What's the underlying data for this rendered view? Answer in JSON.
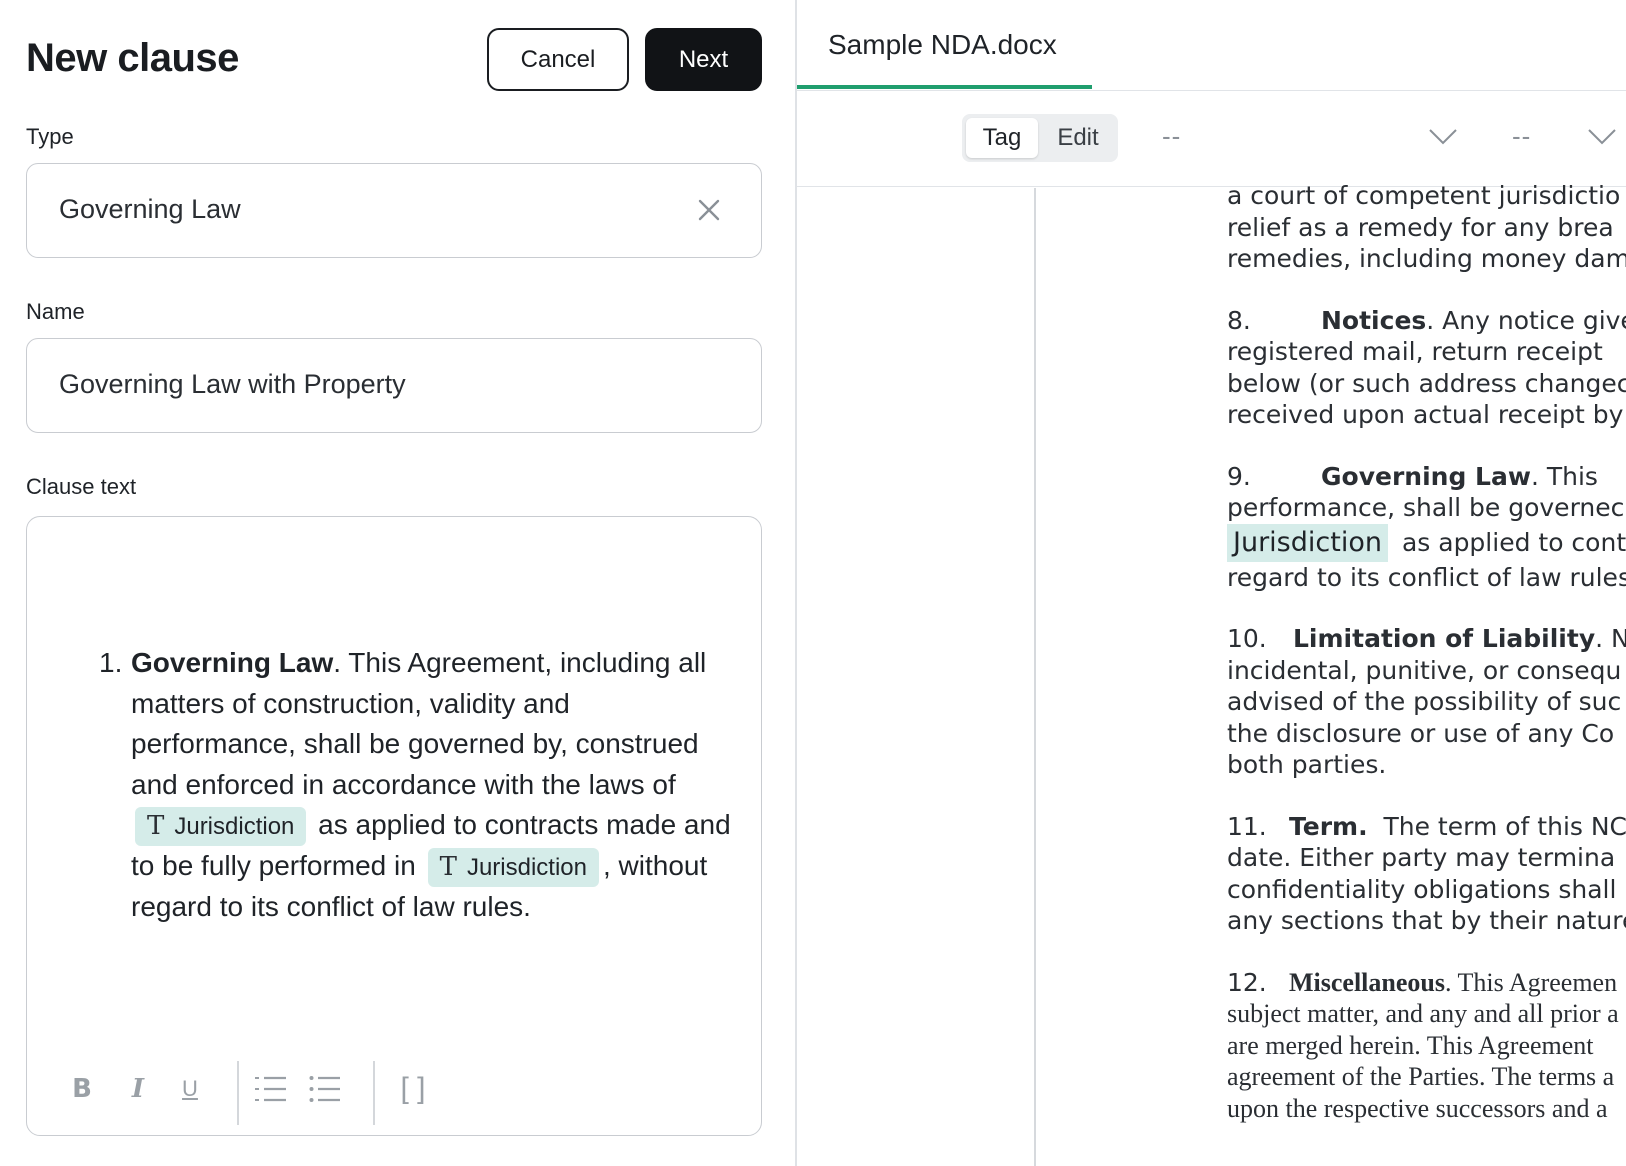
{
  "panel": {
    "title": "New clause",
    "cancel_label": "Cancel",
    "next_label": "Next"
  },
  "type_field": {
    "label": "Type",
    "value": "Governing Law"
  },
  "name_field": {
    "label": "Name",
    "value": "Governing Law with Property"
  },
  "clause_field": {
    "label": "Clause text",
    "number": "1.",
    "heading": "Governing Law",
    "text_1": ". This Agreement, including all matters of construction, validity and performance, shall be governed by, construed and enforced in accordance with the laws of",
    "chip_1": "Jurisdiction",
    "text_2": "as applied to contracts made and to be fully performed in",
    "chip_2": "Jurisdiction",
    "text_3": ", without regard to its conflict of law rules."
  },
  "toolbar": {
    "bold": "B",
    "italic": "I",
    "underline": "U",
    "brackets": "[ ]"
  },
  "document": {
    "tab_title": "Sample NDA.docx",
    "mode_tag": "Tag",
    "mode_edit": "Edit",
    "dash_1": "--",
    "dash_2": "--",
    "lines": {
      "p7_l1": "a court of competent jurisdictio",
      "p7_l2": "relief as a remedy for any brea",
      "p7_l3": "remedies, including money dama",
      "p8_num": "8.",
      "p8_head": "Notices",
      "p8_l1": ". Any notice give",
      "p8_l2": "registered mail, return receipt",
      "p8_l3": "below (or such address changec",
      "p8_l4": "received upon actual receipt by",
      "p9_num": "9.",
      "p9_head": "Governing Law",
      "p9_l1": ". This",
      "p9_l2": "performance, shall be governec",
      "p9_chip": "Jurisdiction",
      "p9_l3": "as applied to cont",
      "p9_l4": "regard to its conflict of law rules",
      "p10_num": "10.",
      "p10_head": "Limitation of Liability",
      "p10_l1": ". N",
      "p10_l2": "incidental, punitive, or consequ",
      "p10_l3": "advised of the possibility of suc",
      "p10_l4": "the disclosure or use of any Co",
      "p10_l5": "both parties.",
      "p11_num": "11.",
      "p11_head": "Term.",
      "p11_l1": "The term of this NC",
      "p11_l2": "date. Either party may termina",
      "p11_l3": "confidentiality obligations shall",
      "p11_l4": "any sections that by their nature",
      "p12_num": "12.",
      "p12_head": "Miscellaneous",
      "p12_l1": ". This Agreemen",
      "p12_l2": "subject matter, and any and all prior a",
      "p12_l3": "are merged herein. This Agreement",
      "p12_l4": "agreement of the Parties. The terms a",
      "p12_l5": "upon the respective successors and a"
    }
  },
  "colors": {
    "accent_green": "#1f9e6e",
    "chip_bg": "#d5ece9",
    "primary_button": "#111316"
  }
}
